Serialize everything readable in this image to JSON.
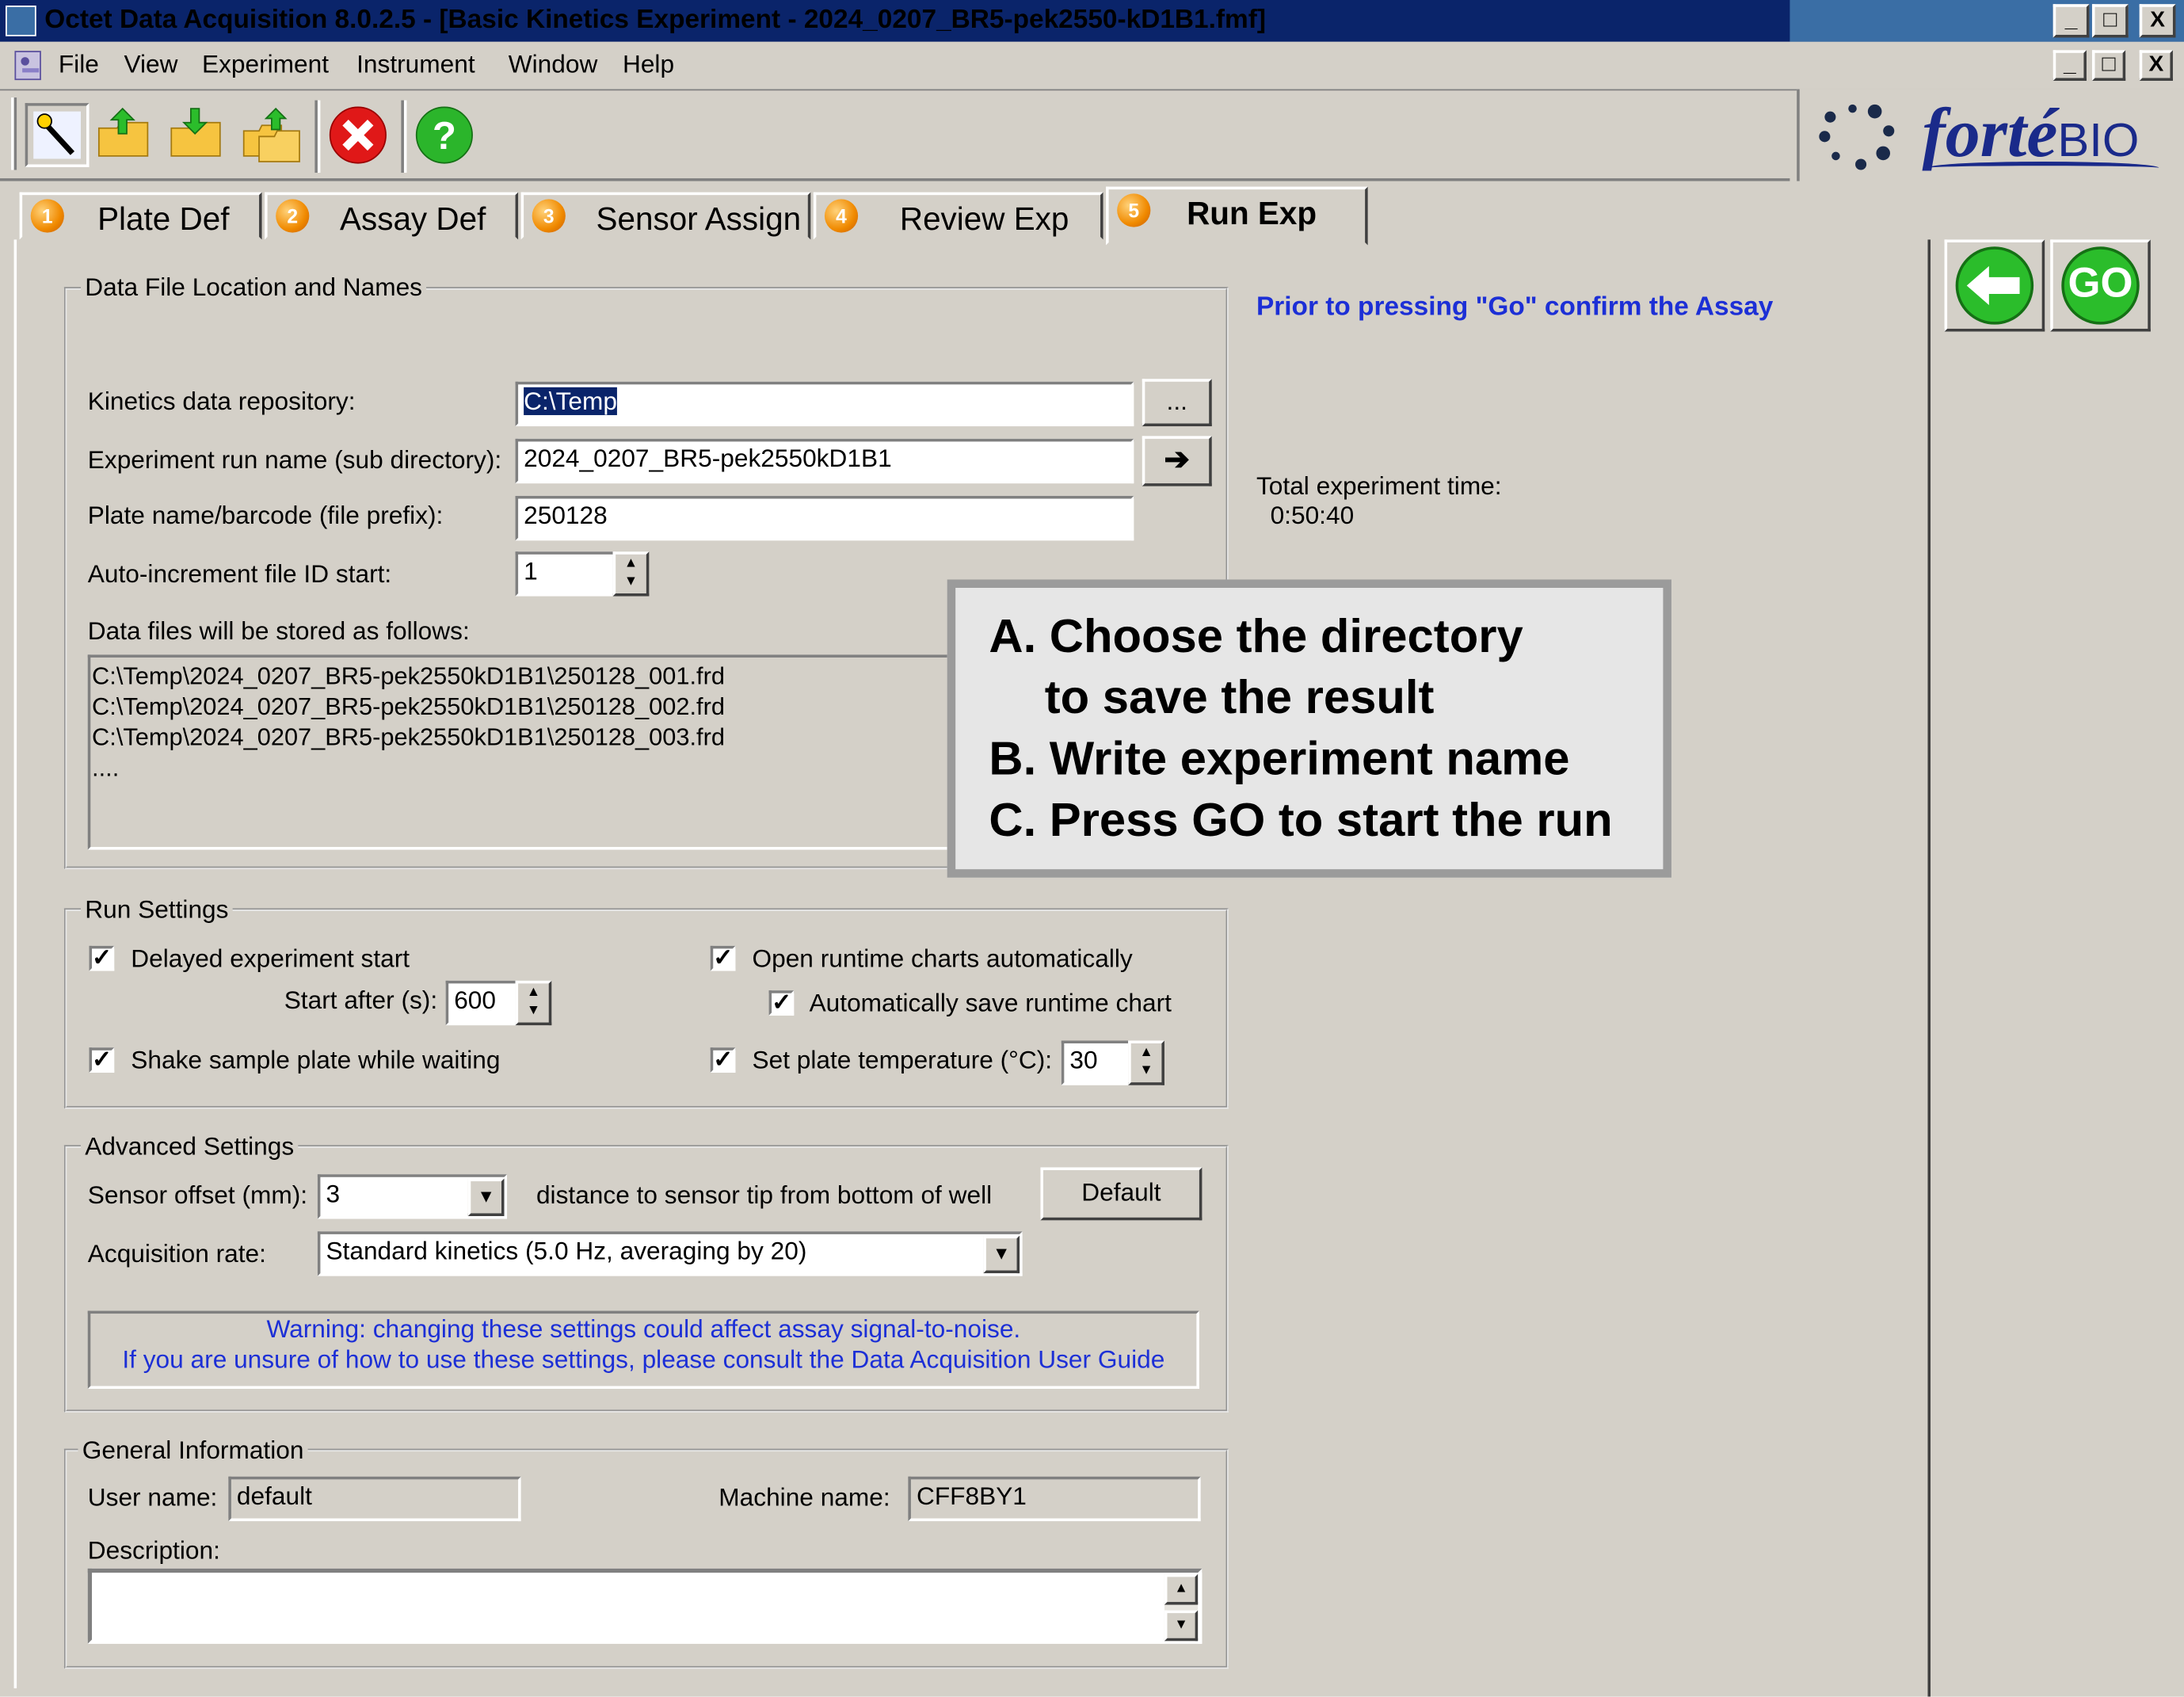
{
  "window": {
    "title": "Octet Data Acquisition 8.0.2.5 - [Basic Kinetics Experiment - 2024_0207_BR5-pek2550-kD1B1.fmf]",
    "minimize": "_",
    "maximize": "□",
    "close": "X"
  },
  "menu": [
    "File",
    "View",
    "Experiment",
    "Instrument",
    "Window",
    "Help"
  ],
  "logo": {
    "text": "fortéBIO",
    "main": "forté",
    "suffix": "BIO"
  },
  "tabs": [
    {
      "num": "1",
      "label": "Plate Def"
    },
    {
      "num": "2",
      "label": "Assay Def"
    },
    {
      "num": "3",
      "label": "Sensor Assign"
    },
    {
      "num": "4",
      "label": "Review Exp"
    },
    {
      "num": "5",
      "label": "Run Exp"
    }
  ],
  "data_file": {
    "group_title": "Data File Location and Names",
    "repo_label": "Kinetics data repository:",
    "repo_value": "C:\\Temp",
    "browse_label": "...",
    "run_name_label": "Experiment run name (sub directory):",
    "run_name_value": "2024_0207_BR5-pek2550kD1B1",
    "arrow_label": "➔",
    "plate_label": "Plate name/barcode (file prefix):",
    "plate_value": "250128",
    "autoinc_label": "Auto-increment file ID start:",
    "autoinc_value": "1",
    "stored_label": "Data files will be stored as follows:",
    "stored_files": [
      "C:\\Temp\\2024_0207_BR5-pek2550kD1B1\\250128_001.frd",
      "C:\\Temp\\2024_0207_BR5-pek2550kD1B1\\250128_002.frd",
      "C:\\Temp\\2024_0207_BR5-pek2550kD1B1\\250128_003.frd",
      "...."
    ]
  },
  "run_settings": {
    "group_title": "Run Settings",
    "delayed_start": "Delayed experiment start",
    "start_after_label": "Start after (s):",
    "start_after_value": "600",
    "shake": "Shake sample plate while waiting",
    "open_charts": "Open runtime charts automatically",
    "auto_save": "Automatically save runtime chart",
    "set_temp": "Set plate temperature (°C):",
    "temp_value": "30",
    "check_mark": "✓"
  },
  "advanced": {
    "group_title": "Advanced Settings",
    "offset_label": "Sensor offset (mm):",
    "offset_value": "3",
    "offset_desc": "distance to sensor tip from bottom of well",
    "default_button": "Default",
    "acq_label": "Acquisition rate:",
    "acq_value": "Standard kinetics (5.0 Hz, averaging by 20)",
    "warning_line1": "Warning: changing these settings could affect assay signal-to-noise.",
    "warning_line2": "If you are unsure of how to use these settings, please consult the Data Acquisition User Guide"
  },
  "general": {
    "group_title": "General Information",
    "user_label": "User name:",
    "user_value": "default",
    "machine_label": "Machine name:",
    "machine_value": "CFF8BY1",
    "desc_label": "Description:"
  },
  "status": {
    "confirm_text": "Prior to pressing \"Go\" confirm the Assay",
    "total_time_label": "Total experiment time:",
    "total_time_value": "0:50:40"
  },
  "nav": {
    "back_icon": "arrow-left-icon",
    "go_label": "GO"
  },
  "callout": {
    "line1": "A. Choose the directory",
    "line2": "to save the result",
    "line3": "B. Write experiment name",
    "line4": "C. Press GO to start the run"
  },
  "colors": {
    "title_bar": "#0a246a",
    "accent_blue": "#1c2fd6",
    "go_green": "#2bbd2b",
    "face": "#d4d0c8"
  }
}
